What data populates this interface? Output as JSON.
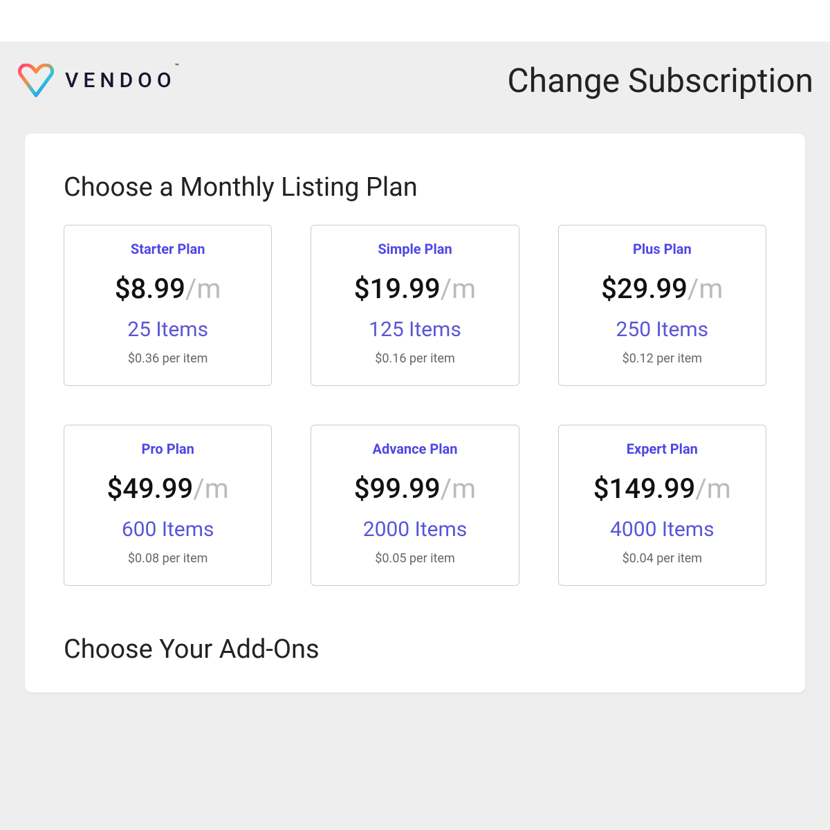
{
  "brand": {
    "name": "VENDOO",
    "tm": "™"
  },
  "header": {
    "title": "Change Subscription"
  },
  "section": {
    "title": "Choose a Monthly Listing Plan"
  },
  "plans": [
    {
      "name": "Starter Plan",
      "price": "$8.99",
      "suffix": "/m",
      "items": "25 Items",
      "per_item": "$0.36 per item"
    },
    {
      "name": "Simple Plan",
      "price": "$19.99",
      "suffix": "/m",
      "items": "125 Items",
      "per_item": "$0.16 per item"
    },
    {
      "name": "Plus Plan",
      "price": "$29.99",
      "suffix": "/m",
      "items": "250 Items",
      "per_item": "$0.12 per item"
    },
    {
      "name": "Pro Plan",
      "price": "$49.99",
      "suffix": "/m",
      "items": "600 Items",
      "per_item": "$0.08 per item"
    },
    {
      "name": "Advance Plan",
      "price": "$99.99",
      "suffix": "/m",
      "items": "2000 Items",
      "per_item": "$0.05 per item"
    },
    {
      "name": "Expert Plan",
      "price": "$149.99",
      "suffix": "/m",
      "items": "4000 Items",
      "per_item": "$0.04 per item"
    }
  ],
  "addons": {
    "title": "Choose Your Add-Ons"
  }
}
